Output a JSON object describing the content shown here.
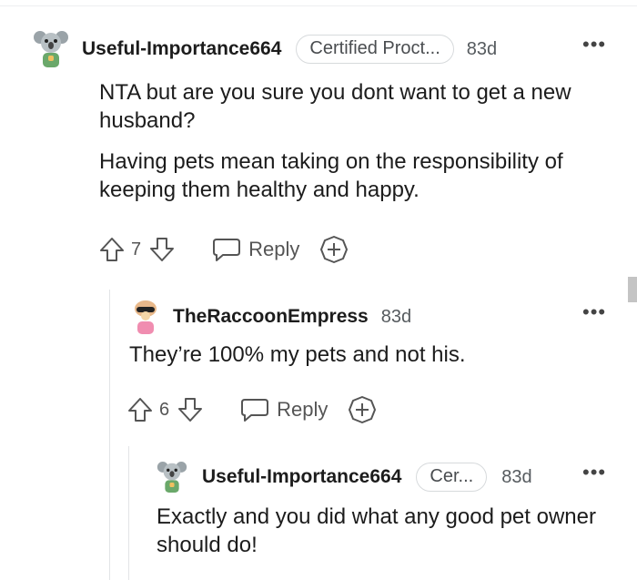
{
  "comments": [
    {
      "username": "Useful-Importance664",
      "flair": "Certified Proct...",
      "time": "83d",
      "more": "•••",
      "paragraphs": [
        "NTA but are you sure you dont want to get a new husband?",
        "Having pets mean taking on the responsibility of keeping them healthy and happy."
      ],
      "score": "7",
      "reply_label": "Reply"
    },
    {
      "username": "TheRaccoonEmpress",
      "time": "83d",
      "more": "•••",
      "paragraphs": [
        "They’re 100% my pets and not his."
      ],
      "score": "6",
      "reply_label": "Reply"
    },
    {
      "username": "Useful-Importance664",
      "flair": "Cer...",
      "time": "83d",
      "more": "•••",
      "paragraphs": [
        "Exactly and you did what any good pet owner should do!"
      ]
    }
  ],
  "icons": {
    "upvote": "arrow-up-icon",
    "downvote": "arrow-down-icon",
    "reply": "speech-bubble-icon",
    "award": "plus-circle-icon",
    "more": "ellipsis-icon"
  },
  "colors": {
    "icon": "#555555",
    "avatar_koala": "#8fbf8f",
    "avatar_raccoon": "#f4c2d0"
  }
}
